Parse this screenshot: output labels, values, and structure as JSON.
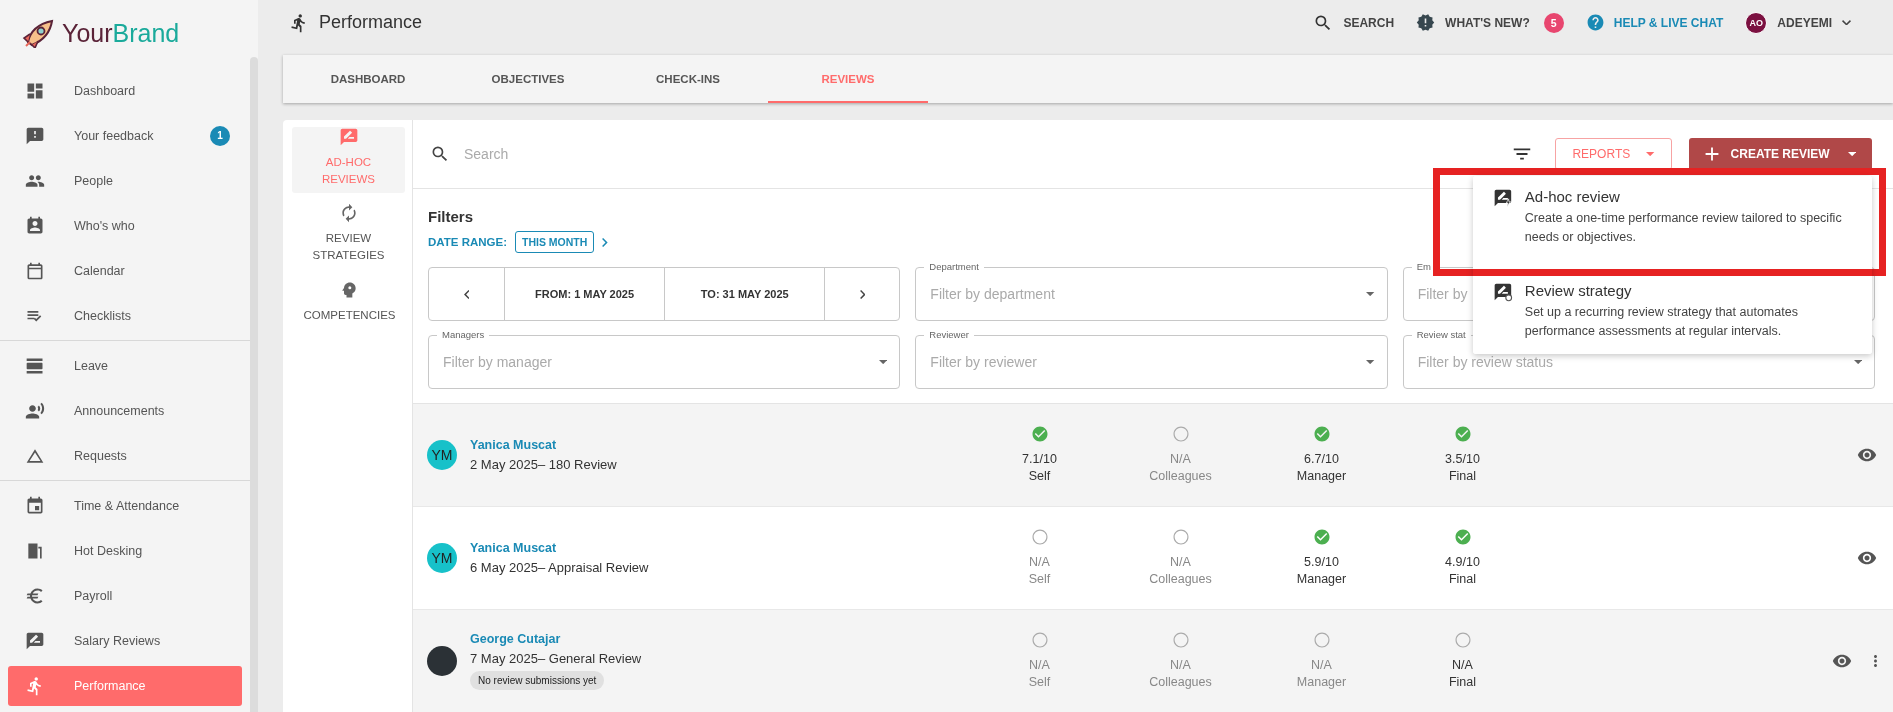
{
  "brand": {
    "first": "Your",
    "second": "Brand"
  },
  "sidebar": {
    "groups": [
      [
        {
          "label": "Dashboard",
          "selected": false
        },
        {
          "label": "Your feedback",
          "selected": false,
          "badge": "1"
        },
        {
          "label": "People",
          "selected": false
        },
        {
          "label": "Who's who",
          "selected": false
        },
        {
          "label": "Calendar",
          "selected": false
        },
        {
          "label": "Checklists",
          "selected": false
        }
      ],
      [
        {
          "label": "Leave",
          "selected": false
        },
        {
          "label": "Announcements",
          "selected": false
        },
        {
          "label": "Requests",
          "selected": false
        }
      ],
      [
        {
          "label": "Time & Attendance",
          "selected": false
        },
        {
          "label": "Hot Desking",
          "selected": false
        },
        {
          "label": "Payroll",
          "selected": false
        },
        {
          "label": "Salary Reviews",
          "selected": false
        },
        {
          "label": "Performance",
          "selected": true
        }
      ]
    ]
  },
  "header": {
    "title": "Performance",
    "search": "SEARCH",
    "whats_new": "WHAT'S NEW?",
    "whats_new_badge": "5",
    "help": "HELP & LIVE CHAT",
    "user_initials": "AO",
    "user_name": "ADEYEMI"
  },
  "tabs": [
    {
      "label": "DASHBOARD",
      "selected": false
    },
    {
      "label": "OBJECTIVES",
      "selected": false
    },
    {
      "label": "CHECK-INS",
      "selected": false
    },
    {
      "label": "REVIEWS",
      "selected": true
    }
  ],
  "subnav": [
    {
      "label": "AD-HOC REVIEWS",
      "selected": true
    },
    {
      "label": "REVIEW STRATEGIES",
      "selected": false
    },
    {
      "label": "COMPETENCIES",
      "selected": false
    }
  ],
  "toolbar": {
    "search_placeholder": "Search",
    "reports": "REPORTS",
    "create": "CREATE REVIEW"
  },
  "filters": {
    "title": "Filters",
    "date_range_label": "DATE RANGE:",
    "date_range_value": "THIS MONTH",
    "from": "FROM: 1 MAY 2025",
    "to": "TO: 31 MAY 2025",
    "fields": [
      {
        "label": "Department",
        "placeholder": "Filter by department"
      },
      {
        "label": "Em",
        "placeholder": "Filter by"
      },
      {
        "label": "Managers",
        "placeholder": "Filter by manager"
      },
      {
        "label": "Reviewer",
        "placeholder": "Filter by reviewer"
      },
      {
        "label": "Review stat",
        "placeholder": "Filter by review status"
      }
    ]
  },
  "reviews": [
    {
      "name": "Yanica Muscat",
      "subtitle": "2 May 2025– 180 Review",
      "avatar": {
        "kind": "initials",
        "text": "YM"
      },
      "has_menu": false,
      "scores": [
        {
          "value": "7.1/10",
          "label": "Self",
          "submitted": true
        },
        {
          "value": "N/A",
          "label": "Colleagues",
          "submitted": false
        },
        {
          "value": "6.7/10",
          "label": "Manager",
          "submitted": true
        },
        {
          "value": "3.5/10",
          "label": "Final",
          "submitted": true
        }
      ]
    },
    {
      "name": "Yanica Muscat",
      "subtitle": "6 May 2025– Appraisal Review",
      "avatar": {
        "kind": "initials",
        "text": "YM"
      },
      "has_menu": false,
      "scores": [
        {
          "value": "N/A",
          "label": "Self",
          "submitted": false
        },
        {
          "value": "N/A",
          "label": "Colleagues",
          "submitted": false
        },
        {
          "value": "5.9/10",
          "label": "Manager",
          "submitted": true
        },
        {
          "value": "4.9/10",
          "label": "Final",
          "submitted": true
        }
      ]
    },
    {
      "name": "George Cutajar",
      "subtitle": "7 May 2025– General Review",
      "avatar": {
        "kind": "photo"
      },
      "note": "No review submissions yet",
      "has_menu": true,
      "scores": [
        {
          "value": "N/A",
          "label": "Self",
          "submitted": false
        },
        {
          "value": "N/A",
          "label": "Colleagues",
          "submitted": false
        },
        {
          "value": "N/A",
          "label": "Manager",
          "submitted": false
        },
        {
          "value": "N/A",
          "label": "Final",
          "submitted": false
        }
      ]
    }
  ],
  "create_menu": [
    {
      "title": "Ad-hoc review",
      "description": "Create a one-time performance review tailored to specific needs or objectives.",
      "highlighted": true
    },
    {
      "title": "Review strategy",
      "description": "Set up a recurring review strategy that automates performance assessments at regular intervals.",
      "highlighted": false
    }
  ]
}
